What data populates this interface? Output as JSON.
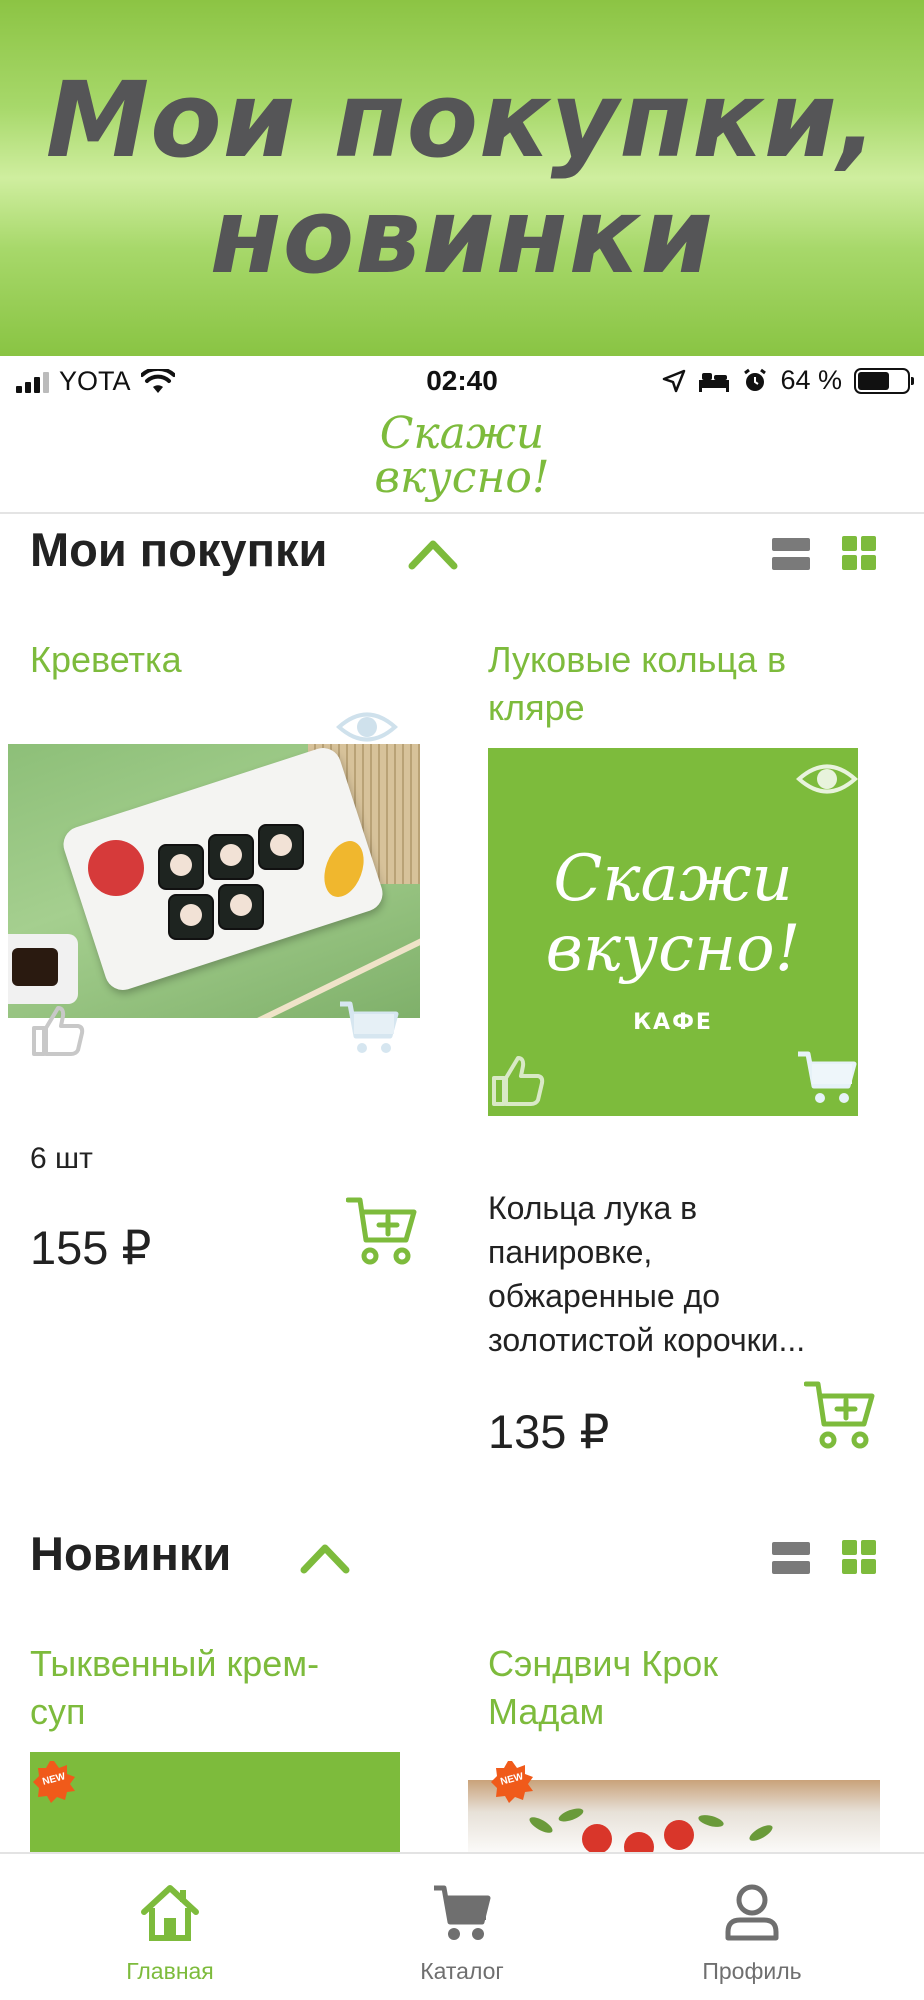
{
  "banner": {
    "line1": "Мои покупки,",
    "line2": "новинки"
  },
  "status_bar": {
    "carrier": "YOTA",
    "time": "02:40",
    "battery": "64 %",
    "battery_level": 0.64
  },
  "app_header": {
    "logo_line1": "Скажи",
    "logo_line2": "вкусно!"
  },
  "sections": [
    {
      "title": "Мои покупки",
      "products": [
        {
          "title": "Креветка",
          "quantity": "6 шт",
          "price": "155 ₽"
        },
        {
          "title_line1": "Луковые кольца в",
          "title_line2": "кляре",
          "placeholder_line1": "Скажи",
          "placeholder_line2": "вкусно!",
          "placeholder_line3": "КАФЕ",
          "desc_line1": "Кольца лука в",
          "desc_line2": "панировке,",
          "desc_line3": "обжаренные до",
          "desc_line4": "золотистой корочки...",
          "price": "135 ₽"
        }
      ]
    },
    {
      "title": "Новинки",
      "products": [
        {
          "title_line1": "Тыквенный крем-",
          "title_line2": "суп",
          "badge": "NEW"
        },
        {
          "title_line1": "Сэндвич Крок",
          "title_line2": "Мадам",
          "badge": "NEW"
        }
      ]
    }
  ],
  "tabbar": [
    {
      "label": "Главная",
      "icon": "home-icon",
      "active": true
    },
    {
      "label": "Каталог",
      "icon": "cart-icon",
      "active": false
    },
    {
      "label": "Профиль",
      "icon": "profile-icon",
      "active": false
    }
  ],
  "colors": {
    "accent": "#7dbb3c",
    "text": "#222222",
    "inactive": "#7a7a7a"
  }
}
